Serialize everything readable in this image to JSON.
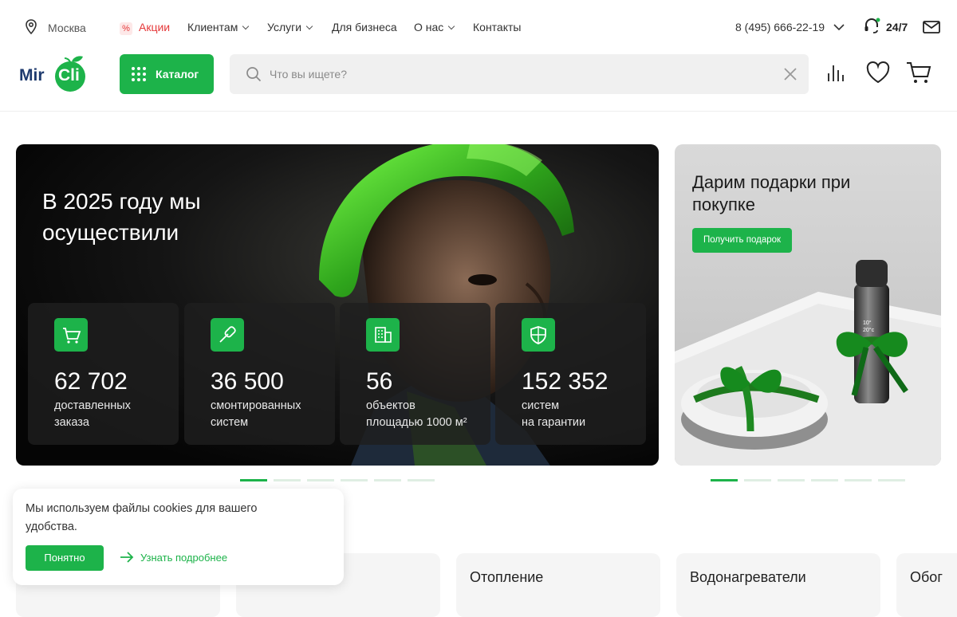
{
  "topbar": {
    "city": "Москва",
    "promo_icon": "%",
    "promo_label": "Акции",
    "menu": [
      "Клиентам",
      "Услуги",
      "Для бизнеса",
      "О нас",
      "Контакты"
    ],
    "phone": "8 (495) 666-22-19",
    "support_label": "24/7"
  },
  "header": {
    "logo_text_1": "Mir",
    "logo_text_2": "Cli",
    "catalog_label": "Каталог",
    "search_placeholder": "Что вы ищете?"
  },
  "hero": {
    "title": "В 2025 году мы осуществили",
    "stats": [
      {
        "icon": "cart-icon",
        "number": "62 702",
        "caption": "доставленных\nзаказа"
      },
      {
        "icon": "screwdriver-icon",
        "number": "36 500",
        "caption": "смонтированных\nсистем"
      },
      {
        "icon": "building-icon",
        "number": "56",
        "caption": "объектов\nплощадью 1000 м²"
      },
      {
        "icon": "shield-icon",
        "number": "152 352",
        "caption": "систем\nна гарантии"
      }
    ],
    "slides_total": 6,
    "active_slide": 1
  },
  "promo": {
    "title": "Дарим подарки при покупке",
    "button_label": "Получить подарок",
    "flask_display": "10°\n20°c",
    "slides_total": 6,
    "active_slide": 1
  },
  "categories": [
    {
      "label": ""
    },
    {
      "label": ""
    },
    {
      "label": "Отопление"
    },
    {
      "label": "Водонагреватели"
    },
    {
      "label": "Обог"
    }
  ],
  "cookie": {
    "text": "Мы используем файлы cookies для вашего удобства.",
    "accept_label": "Понятно",
    "more_label": "Узнать подробнее"
  },
  "colors": {
    "brand_green": "#1db34a",
    "promo_red": "#e5393a",
    "logo_blue": "#1e3a6e"
  }
}
